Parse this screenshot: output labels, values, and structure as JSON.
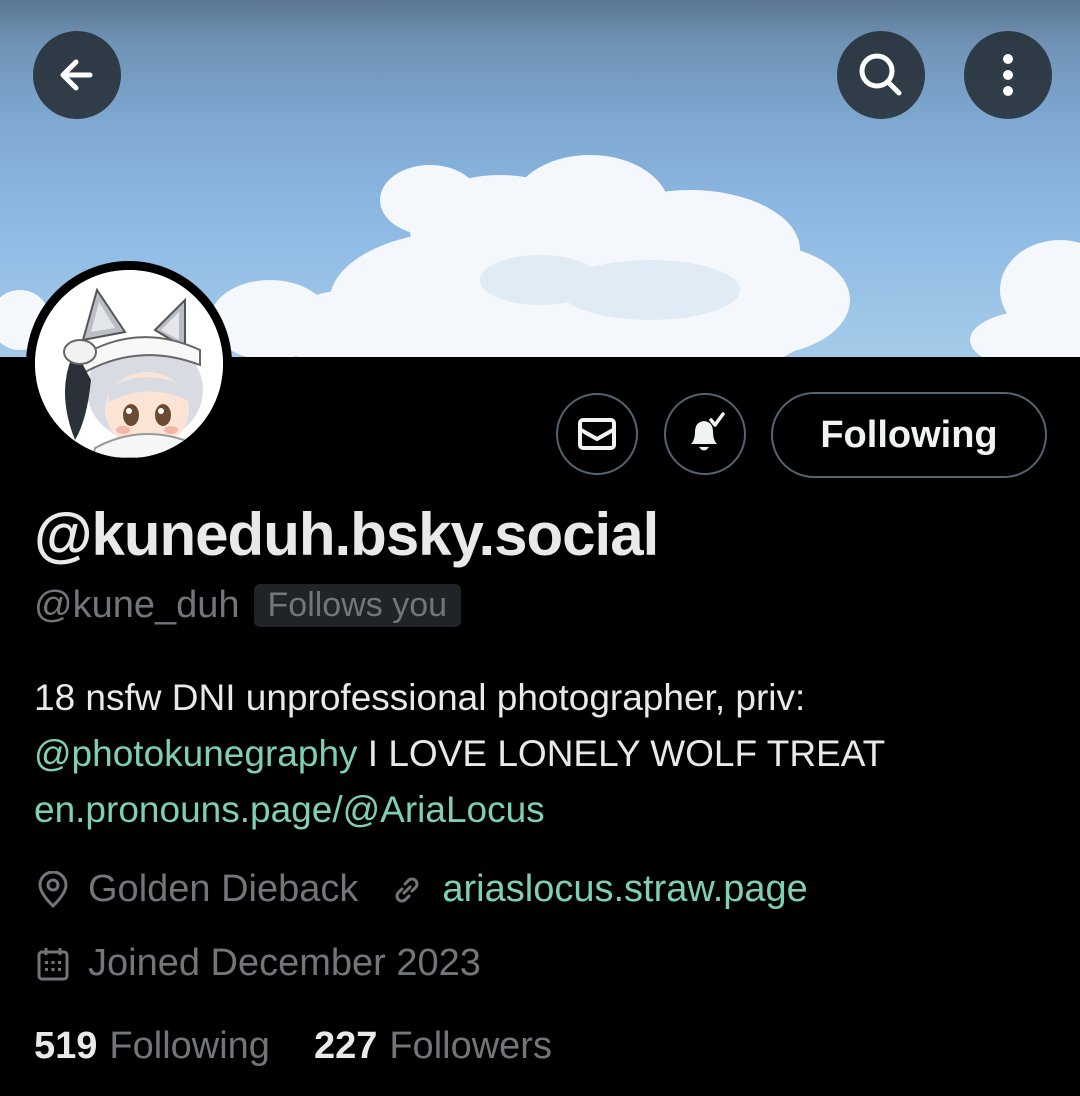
{
  "header": {
    "back_icon": "arrow-left-icon",
    "search_icon": "search-icon",
    "more_icon": "more-vertical-icon"
  },
  "actions": {
    "message_icon": "mail-icon",
    "notify_icon": "bell-check-icon",
    "follow_label": "Following"
  },
  "profile": {
    "display_name": "@kuneduh.bsky.social",
    "handle": "@kune_duh",
    "follows_you": "Follows you",
    "bio_line1": "18 nsfw DNI unprofessional photographer, priv:",
    "bio_mention": "@photokunegraphy",
    "bio_line2_rest": " I LOVE LONELY WOLF TREAT",
    "bio_link": "en.pronouns.page/@AriaLocus",
    "location": "Golden Dieback",
    "website": "ariaslocus.straw.page",
    "joined": "Joined December 2023"
  },
  "stats": {
    "following_count": "519",
    "following_label": "Following",
    "followers_count": "227",
    "followers_label": "Followers"
  },
  "colors": {
    "background": "#000000",
    "text": "#e7e9ea",
    "muted": "#71767b",
    "link": "#7fcfb8",
    "border": "#536471"
  }
}
